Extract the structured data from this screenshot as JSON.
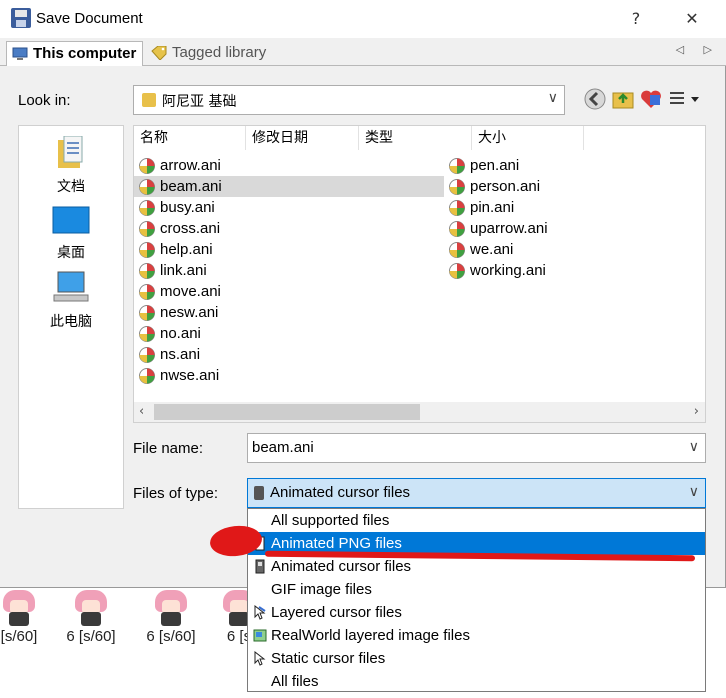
{
  "window": {
    "title": "Save Document",
    "help_label": "?",
    "close_label": "✕"
  },
  "tabs": [
    {
      "label": "This computer",
      "active": true
    },
    {
      "label": "Tagged library",
      "active": false
    }
  ],
  "tab_scroll": "◁ ▷",
  "look_in": {
    "label": "Look in:",
    "value": "阿尼亚 基础"
  },
  "places": [
    {
      "label": "文档",
      "icon": "documents-icon"
    },
    {
      "label": "桌面",
      "icon": "desktop-icon"
    },
    {
      "label": "此电脑",
      "icon": "this-pc-icon"
    }
  ],
  "columns": [
    "名称",
    "修改日期",
    "类型",
    "大小"
  ],
  "files_col1": [
    "arrow.ani",
    "beam.ani",
    "busy.ani",
    "cross.ani",
    "help.ani",
    "link.ani",
    "move.ani",
    "nesw.ani",
    "no.ani",
    "ns.ani",
    "nwse.ani"
  ],
  "files_col2": [
    "pen.ani",
    "person.ani",
    "pin.ani",
    "uparrow.ani",
    "we.ani",
    "working.ani"
  ],
  "selected_file": "beam.ani",
  "file_name": {
    "label": "File name:",
    "value": "beam.ani"
  },
  "file_type": {
    "label": "Files of type:",
    "value": "Animated cursor files"
  },
  "type_options": [
    "All supported files",
    "Animated PNG files",
    "Animated cursor files",
    "GIF image files",
    "Layered cursor files",
    "RealWorld layered image files",
    "Static cursor files",
    "All files"
  ],
  "highlighted_option": "Animated PNG files",
  "background_frames": [
    "[s/60]",
    "6 [s/60]",
    "6 [s/60]",
    "6 [s"
  ],
  "colors": {
    "accent": "#0078d7",
    "annotation": "#e01818",
    "selection": "#d9d9d9"
  }
}
